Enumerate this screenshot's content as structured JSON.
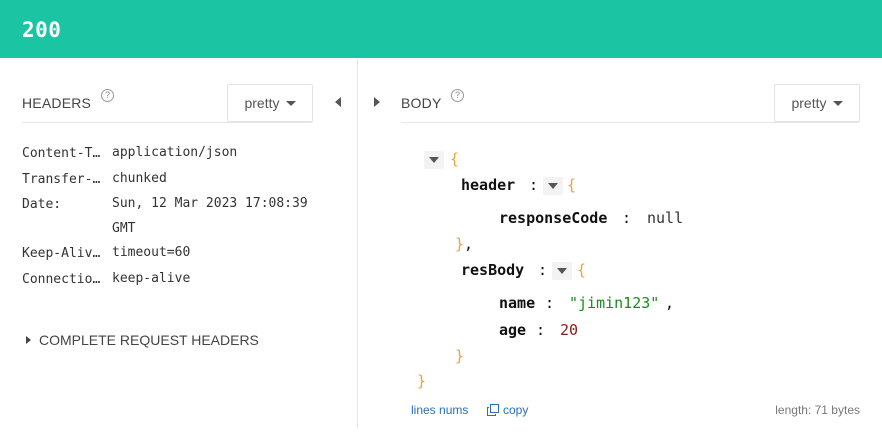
{
  "status": {
    "code": "200",
    "color": "#1bc4a3"
  },
  "headers_panel": {
    "title": "HEADERS",
    "help": "?",
    "format_label": "pretty",
    "rows": [
      {
        "key": "Content-T…",
        "value": "application/json"
      },
      {
        "key": "Transfer-…",
        "value": "chunked"
      },
      {
        "key": "Date:",
        "value": "Sun, 12 Mar 2023 17:08:39 GMT"
      },
      {
        "key": "Keep-Aliv…",
        "value": "timeout=60"
      },
      {
        "key": "Connectio…",
        "value": "keep-alive"
      }
    ],
    "complete_label": "COMPLETE REQUEST HEADERS"
  },
  "body_panel": {
    "title": "BODY",
    "help": "?",
    "format_label": "pretty",
    "json": {
      "open": "{",
      "close": "}",
      "header_key": "header",
      "response_code_key": "responseCode",
      "response_code_value": "null",
      "header_close": "},",
      "resbody_key": "resBody",
      "name_key": "name",
      "name_value": "\"jimin123\"",
      "age_key": "age",
      "age_value": "20",
      "colon": ":",
      "comma": ","
    },
    "lines_nums_label": "lines nums",
    "copy_label": "copy",
    "length_label": "length: 71 bytes"
  }
}
